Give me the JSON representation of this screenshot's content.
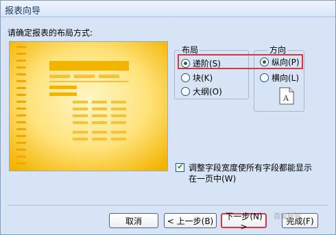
{
  "window": {
    "title": "报表向导"
  },
  "prompt": "请确定报表的布局方式:",
  "layout_group": {
    "title": "布局",
    "options": [
      {
        "label": "递阶(S)",
        "selected": true
      },
      {
        "label": "块(K)",
        "selected": false
      },
      {
        "label": "大纲(O)",
        "selected": false
      }
    ]
  },
  "direction_group": {
    "title": "方向",
    "options": [
      {
        "label": "纵向(P)",
        "selected": true
      },
      {
        "label": "横向(L)",
        "selected": false
      }
    ],
    "icon": "portrait-page-icon",
    "icon_letter": "A"
  },
  "checkbox": {
    "label": "调整字段宽度使所有字段都能显示在一页中(W)",
    "checked": true
  },
  "buttons": {
    "cancel": "取消",
    "back": "< 上一步(B)",
    "next": "下一步(N) >",
    "finish": "完成(F)"
  },
  "watermark": "百度经验",
  "colors": {
    "highlight": "#d9333f",
    "preview_orange": "#f3b400",
    "preview_yellow": "#ffe27a"
  }
}
